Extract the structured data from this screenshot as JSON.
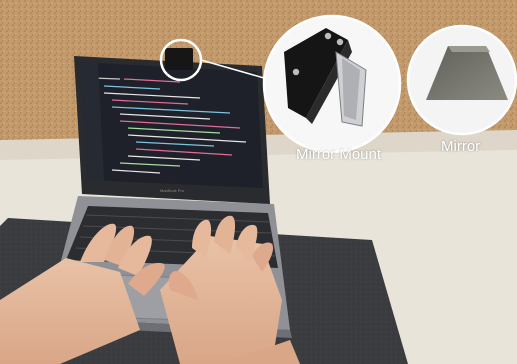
{
  "callouts": {
    "mount_label": "Mirror Mount",
    "mirror_label": "Mirror"
  },
  "laptop": {
    "brand_text": "MacBook Pro"
  },
  "colors": {
    "cork_wall": "#c39a6c",
    "desk": "#e9e4da",
    "felt_mat": "#3b3c3f",
    "laptop_body": "#8f9196",
    "screen_bg": "#1e2129"
  }
}
